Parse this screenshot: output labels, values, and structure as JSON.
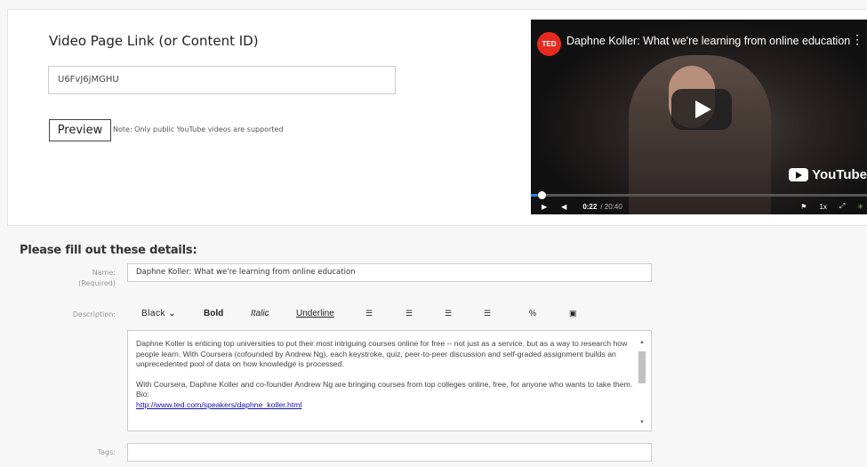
{
  "content": {
    "label": "Video Page Link (or Content ID)",
    "content_id_value": "U6FvJ6jMGHU",
    "preview_label": "Preview",
    "note": "Note: Only public YouTube videos are supported"
  },
  "video": {
    "ted_logo": "TED",
    "title": "Daphne Koller: What we're learning from online education",
    "kebab": "⋮",
    "youtube_label": "YouTube",
    "current_time": "0:22",
    "total_time": "/ 20:40",
    "speed": "1x",
    "progress_fraction": 0.018,
    "accent_color": "#1e88e5"
  },
  "details": {
    "heading": "Please fill out these details:",
    "name_label": "Name:",
    "name_required": "(Required)",
    "name_value": "Daphne Koller: What we're learning from online education",
    "description_label": "Description:",
    "tags_label": "Tags:",
    "toolbar": {
      "color": "Black",
      "bold": "Bold",
      "italic": "Italic",
      "underline": "Underline"
    },
    "description_paragraph_1": "Daphne Koller is enticing top universities to put their most intriguing courses online for free -- not just as a service, but as a way to research how people learn. With Coursera (cofounded by Andrew Ng), each keystroke, quiz, peer-to-peer discussion and self-graded assignment builds an unprecedented pool of data on how knowledge is processed.",
    "description_paragraph_2": "With Coursera, Daphne Koller and co-founder Andrew Ng are bringing courses from top colleges online, free, for anyone who wants to take them. Bio:",
    "description_link": "http://www.ted.com/speakers/daphne_koller.html"
  }
}
